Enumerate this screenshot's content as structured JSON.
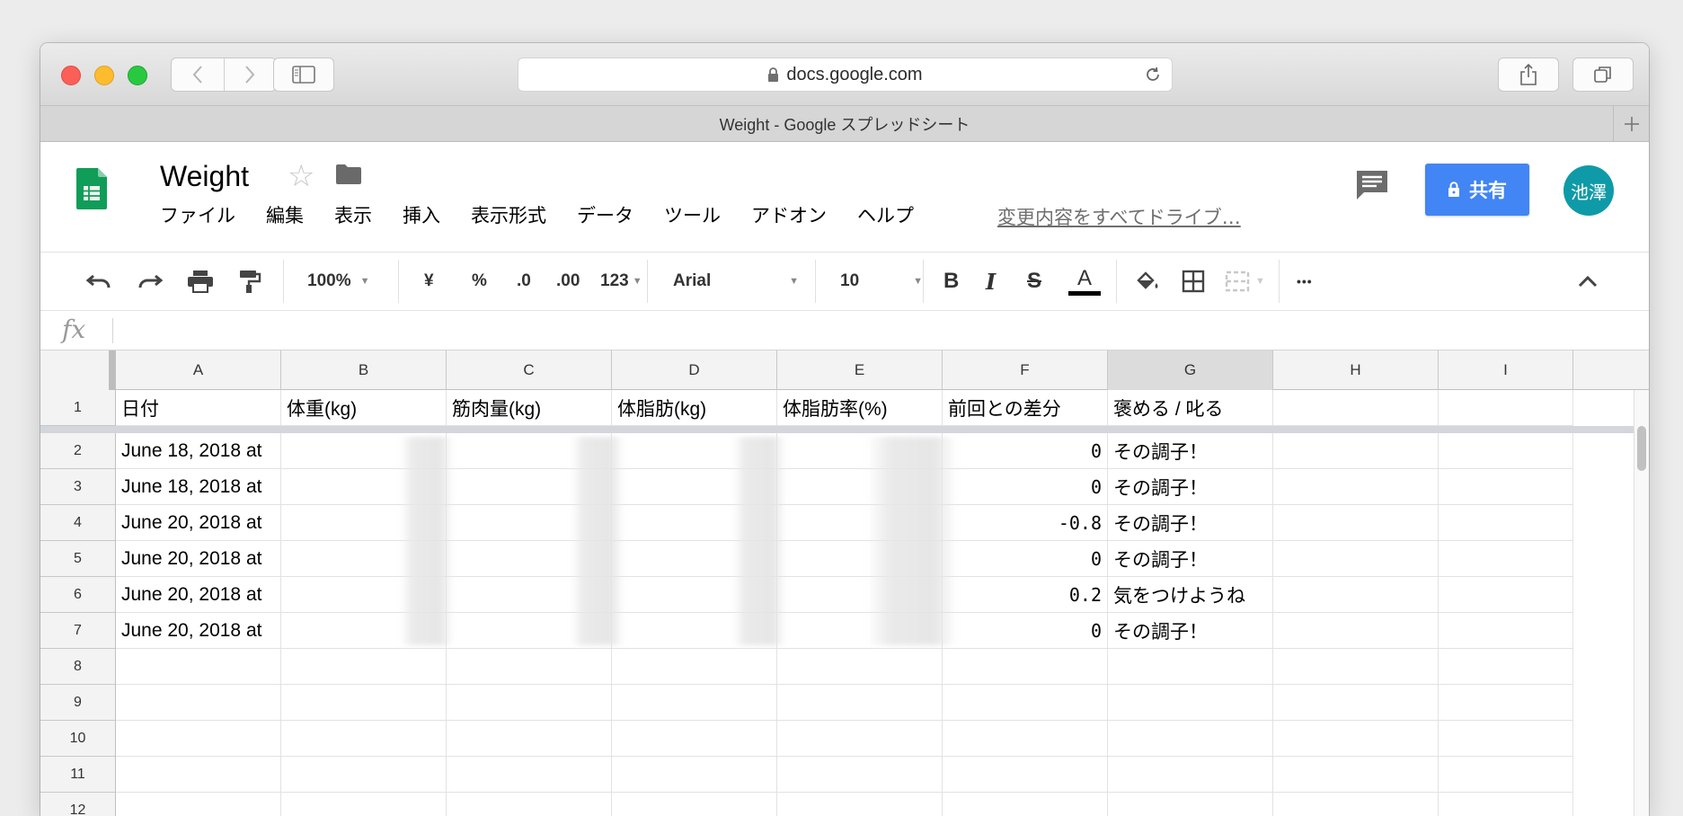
{
  "browser": {
    "url": "docs.google.com",
    "tab_title": "Weight - Google スプレッドシート"
  },
  "doc": {
    "title": "Weight",
    "menu": [
      "ファイル",
      "編集",
      "表示",
      "挿入",
      "表示形式",
      "データ",
      "ツール",
      "アドオン",
      "ヘルプ"
    ],
    "save_status": "変更内容をすべてドライブ…",
    "share_label": "共有",
    "avatar_text": "池澤"
  },
  "toolbar": {
    "zoom": "100%",
    "currency": "¥",
    "percent": "%",
    "dec_decrease": ".0",
    "dec_increase": ".00",
    "more_formats": "123",
    "font": "Arial",
    "font_size": "10",
    "bold": "B",
    "italic": "I",
    "strike": "S",
    "text_color": "A",
    "more": "•••"
  },
  "formula_bar": {
    "fx": "fx"
  },
  "sheet": {
    "columns": [
      "A",
      "B",
      "C",
      "D",
      "E",
      "F",
      "G",
      "H",
      "I"
    ],
    "headers": [
      "日付",
      "体重(kg)",
      "筋肉量(kg)",
      "体脂肪(kg)",
      "体脂肪率(%)",
      "前回との差分",
      "褒める / 叱る",
      "",
      ""
    ],
    "rows": [
      {
        "num": "1"
      },
      {
        "num": "2",
        "date": "June 18, 2018 at",
        "diff": "0",
        "comment": "その調子！"
      },
      {
        "num": "3",
        "date": "June 18, 2018 at",
        "diff": "0",
        "comment": "その調子！"
      },
      {
        "num": "4",
        "date": "June 20, 2018 at",
        "diff": "-0.8",
        "comment": "その調子！"
      },
      {
        "num": "5",
        "date": "June 20, 2018 at",
        "diff": "0",
        "comment": "その調子！"
      },
      {
        "num": "6",
        "date": "June 20, 2018 at",
        "diff": "0.2",
        "comment": "気をつけようね"
      },
      {
        "num": "7",
        "date": "June 20, 2018 at",
        "diff": "0",
        "comment": "その調子！"
      },
      {
        "num": "8"
      },
      {
        "num": "9"
      },
      {
        "num": "10"
      },
      {
        "num": "11"
      },
      {
        "num": "12"
      }
    ]
  },
  "colors": {
    "share_button": "#4285f4",
    "sheets_green": "#0f9d58",
    "avatar": "#0f9aa8"
  }
}
